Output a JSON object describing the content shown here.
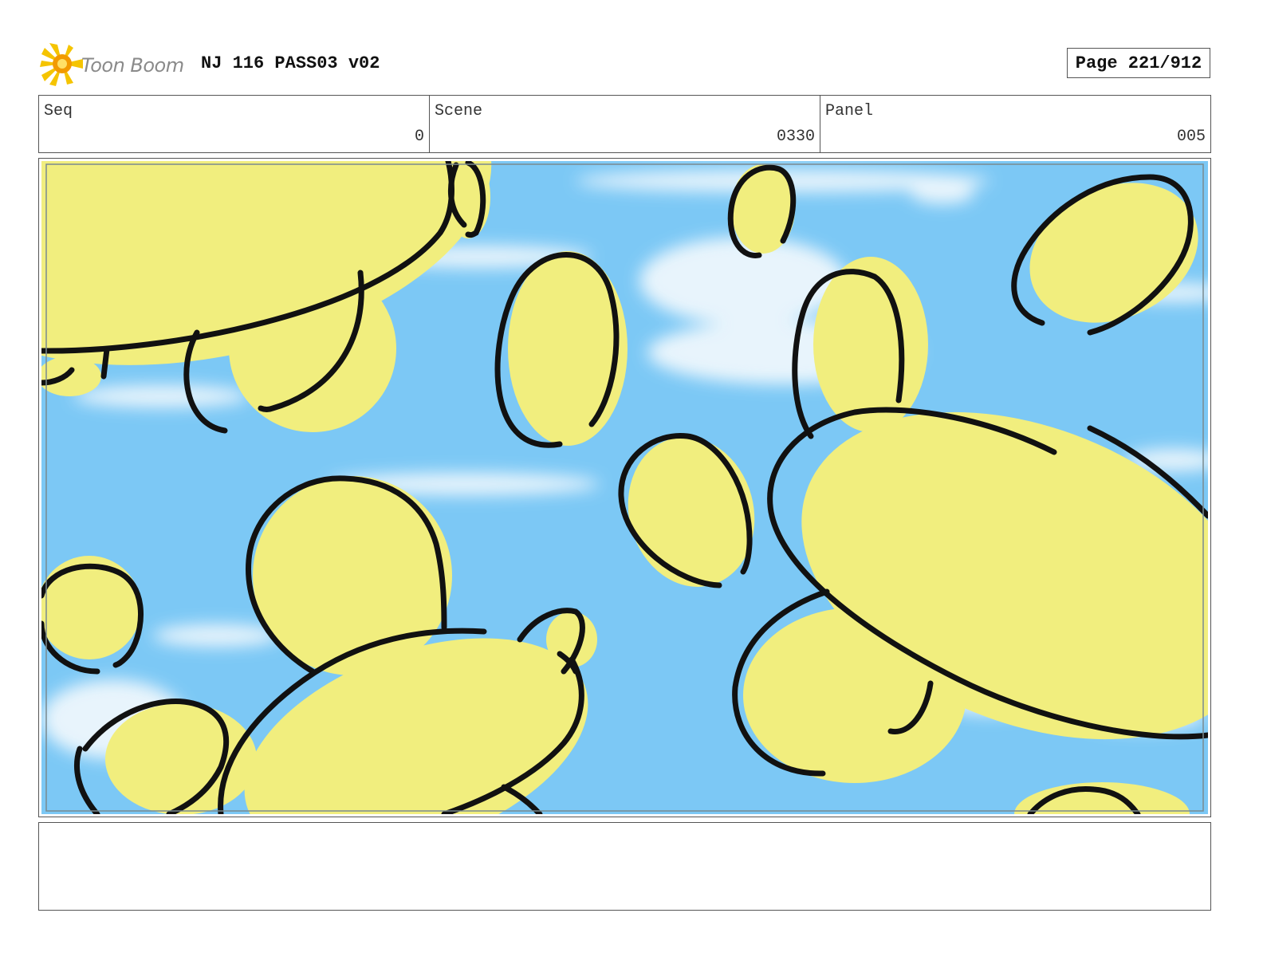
{
  "header": {
    "logo_text": "Toon Boom",
    "title": "NJ 116 PASS03 v02",
    "page_label": "Page 221/912"
  },
  "info": {
    "seq_label": "Seq",
    "seq_value": "0",
    "scene_label": "Scene",
    "scene_value": "0330",
    "panel_label": "Panel",
    "panel_value": "005"
  },
  "artwork": {
    "sky_color": "#7cc8f5",
    "cloud_color": "#f4f9fd",
    "fill_color": "#f1ee7e",
    "outline_color": "#111111",
    "frame_line_color": "#7a8a90"
  },
  "notes": {
    "text": ""
  }
}
